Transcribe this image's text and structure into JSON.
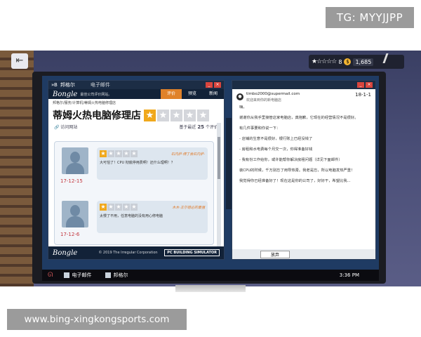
{
  "watermarks": {
    "tg": "TG: MYYJJPP",
    "url": "www.bing-xingkongsports.com"
  },
  "hud": {
    "stars": "★☆☆☆☆",
    "level": "8",
    "coin_symbol": "$",
    "money": "1,685"
  },
  "left_window": {
    "tab1": "邦格尔",
    "tab2": "电子邮件",
    "brand": "Bongle",
    "brand_sub": "最佳公司评价网站。",
    "nav_tabs": [
      "评价",
      "预览",
      "新闻"
    ],
    "breadcrumb": "邦格尔/服务/计算机/蒂姆火热电脑修理店",
    "shop_title": "蒂姆火热电脑修理店",
    "rating_on": 1,
    "rating_total": 5,
    "visit_label": "访问网站",
    "review_count_prefix": "基于最近",
    "review_count": "25",
    "review_count_suffix": "个评价",
    "reviews": [
      {
        "name": "石内萨·傅丁舍石内萨·",
        "text": "大可怕了！CPU 彻底停用费啊！还什么理啊！？",
        "date": "17-12-15",
        "stars_on": 1
      },
      {
        "name": "木木·王尔德必的最强",
        "text": "太慢了不用，任意电脑的没有用心修电脑",
        "date": "17-12-6",
        "stars_on": 1
      }
    ],
    "footer_brand": "Bongle",
    "footer_copy": "© 2019 The Irregular Corporation",
    "footer_badge": "PC BUILDING SIMULATOR"
  },
  "right_window": {
    "from": "timbo2000@supermail.com",
    "subject": "欢迎来到你的新电脑店",
    "date": "18-1-1",
    "body": [
      "嗨，",
      "谢谢你从我手里接管这家电脑店，真抱歉，它现在的经营情况不是很好。",
      "有几件事要和你说一下：",
      "- 店铺的生意不是很好，银行账上已经没钱了",
      "- 房租和水电费每个月交一次，你得准备好钱",
      "- 我有份工作给你，或许能帮你解决房租问题（详见下面邮件）",
      "装CPU的时候，千万别忘了用导热膏。我老是忘，所以电脑发热严重！",
      "我觉得你已经准备好了！现在这是你的公司了，好好干，希望比我..."
    ],
    "give_up": "放弃"
  },
  "taskbar": {
    "email": "电子邮件",
    "bongle": "邦格尔",
    "time": "3:36 PM"
  }
}
